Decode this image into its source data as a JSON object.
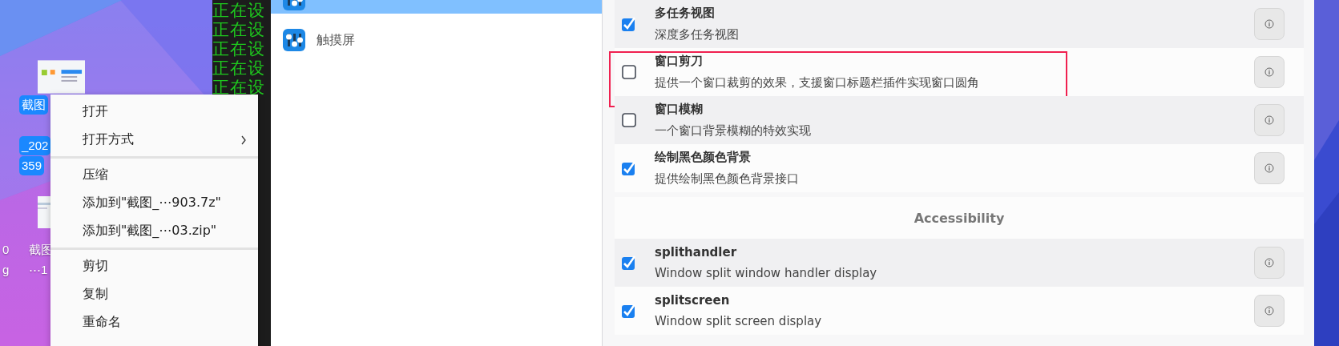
{
  "desktop": {
    "icons": [
      {
        "kind": "thumb",
        "labels": [
          {
            "text": "截图",
            "selected": true
          }
        ]
      },
      {
        "kind": "thumb",
        "labels": [
          {
            "text": "_202",
            "selected": true
          },
          {
            "text": "359",
            "selected": true
          }
        ]
      },
      {
        "labels": [
          {
            "text": "0",
            "selected": false
          },
          {
            "text": "g",
            "selected": false
          }
        ]
      },
      {
        "labels": [
          {
            "text": "截图",
            "selected": false
          },
          {
            "text": "⋯1",
            "selected": false
          }
        ]
      }
    ]
  },
  "terminal": {
    "lines": [
      "正在设",
      "正在设",
      "正在设",
      "正在设",
      "正在设"
    ]
  },
  "context_menu": {
    "items": [
      {
        "kind": "item",
        "label": "打开"
      },
      {
        "kind": "submenu",
        "label": "打开方式"
      },
      {
        "kind": "separator"
      },
      {
        "kind": "item",
        "label": "压缩"
      },
      {
        "kind": "item",
        "label": "添加到\"截图_⋯903.7z\""
      },
      {
        "kind": "item",
        "label": "添加到\"截图_⋯03.zip\""
      },
      {
        "kind": "separator"
      },
      {
        "kind": "item",
        "label": "剪切"
      },
      {
        "kind": "item",
        "label": "复制"
      },
      {
        "kind": "item",
        "label": "重命名"
      }
    ]
  },
  "sidebar": {
    "items": [
      {
        "selected": true
      },
      {
        "label": "触摸屏",
        "selected": false
      }
    ]
  },
  "plugins": {
    "items": [
      {
        "kind": "plugin",
        "title": "多任务视图",
        "description": "深度多任务视图",
        "checked": true,
        "highlighted": false
      },
      {
        "kind": "plugin",
        "title": "窗口剪刀",
        "description": "提供一个窗口裁剪的效果，支援窗口标题栏插件实现窗口圆角",
        "checked": false,
        "highlighted": true
      },
      {
        "kind": "plugin",
        "title": "窗口模糊",
        "description": "一个窗口背景模糊的特效实现",
        "checked": false,
        "highlighted": false
      },
      {
        "kind": "plugin",
        "title": "绘制黑色颜色背景",
        "description": "提供绘制黑色颜色背景接口",
        "checked": true,
        "highlighted": false
      },
      {
        "kind": "section",
        "title": "Accessibility"
      },
      {
        "kind": "plugin",
        "title": "splithandler",
        "description": "Window split window handler display",
        "checked": true,
        "highlighted": false
      },
      {
        "kind": "plugin",
        "title": "splitscreen",
        "description": "Window split screen display",
        "checked": true,
        "highlighted": false
      }
    ]
  }
}
